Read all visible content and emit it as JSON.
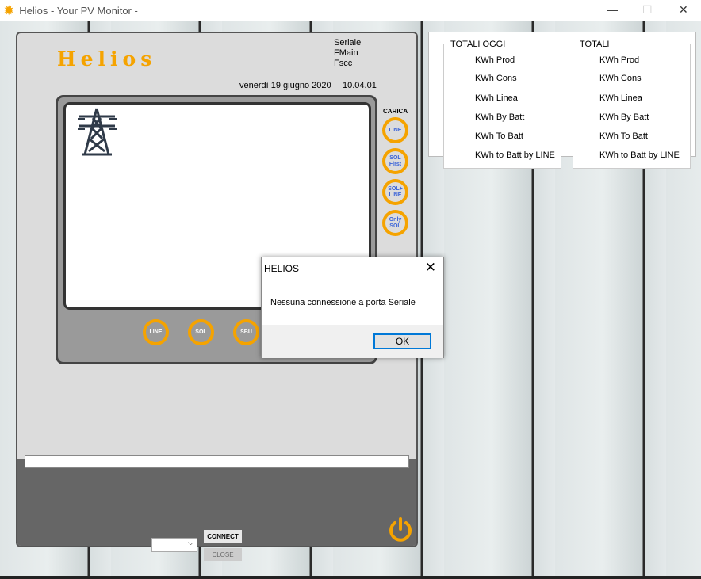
{
  "window": {
    "title": "Helios  -  Your PV Monitor  -",
    "app_icon": "sun-icon",
    "minimize": "—",
    "maximize": "☐",
    "close": "✕"
  },
  "panel": {
    "logo": "Helios",
    "info": [
      "Seriale",
      "FMain",
      "Fscc"
    ],
    "date": "venerdì 19 giugno 2020",
    "time": "10.04.01",
    "screen_icon": "power-pylon-icon",
    "carica": {
      "label": "CARICA",
      "modes": [
        "LINE",
        "SOL First",
        "SOL+ LINE",
        "Only SOL"
      ]
    },
    "sources": [
      "LINE",
      "SOL",
      "SBU"
    ],
    "connect_label": "CONNECT",
    "close_label": "CLOSE",
    "port_value": ""
  },
  "totals": {
    "today": {
      "title": "TOTALI  OGGI",
      "rows": [
        "KWh Prod",
        "KWh Cons",
        "KWh Linea",
        "KWh By Batt",
        "KWh To Batt",
        "KWh to Batt by LINE"
      ]
    },
    "total": {
      "title": "TOTALI",
      "rows": [
        "KWh Prod",
        "KWh Cons",
        "KWh Linea",
        "KWh By Batt",
        "KWh To Batt",
        "KWh to Batt by LINE"
      ]
    }
  },
  "dialog": {
    "title": "HELIOS",
    "message": "Nessuna connessione a porta Seriale",
    "ok": "OK",
    "close": "✕"
  },
  "colors": {
    "accent": "#f5a300",
    "mode_text": "#3a63d8",
    "dialog_focus": "#0078d7"
  }
}
